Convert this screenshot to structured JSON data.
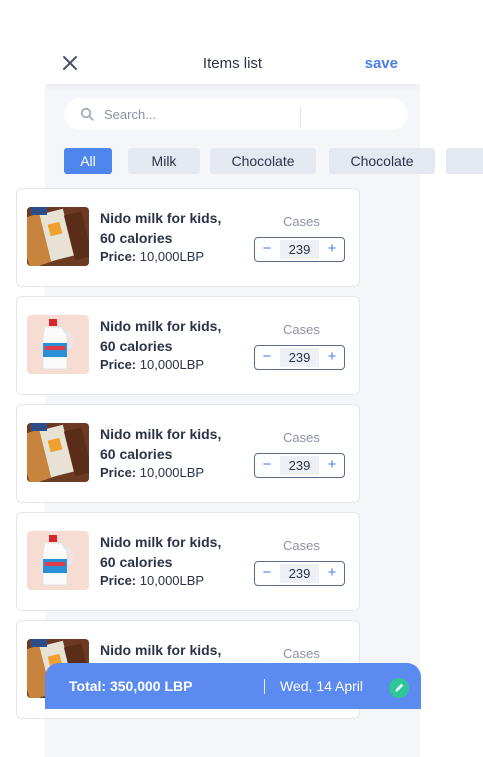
{
  "header": {
    "title": "Items list",
    "save_label": "save",
    "close_icon": "close-icon"
  },
  "search": {
    "placeholder": "Search...",
    "value": "",
    "icon": "search-icon"
  },
  "filters": [
    "All",
    "Milk",
    "Chocolate",
    "Chocolate",
    ""
  ],
  "active_filter": "All",
  "items": [
    {
      "name": "Nido milk for kids, 60 calories",
      "price_label": "Price:",
      "price": "10,000LBP",
      "qty_label": "Cases",
      "qty": "239",
      "image": "chocolate-bar-image"
    },
    {
      "name": "Nido milk for kids, 60 calories",
      "price_label": "Price:",
      "price": "10,000LBP",
      "qty_label": "Cases",
      "qty": "239",
      "image": "milk-jug-image"
    },
    {
      "name": "Nido milk for kids, 60 calories",
      "price_label": "Price:",
      "price": "10,000LBP",
      "qty_label": "Cases",
      "qty": "239",
      "image": "chocolate-bar-image"
    },
    {
      "name": "Nido milk for kids, 60 calories",
      "price_label": "Price:",
      "price": "10,000LBP",
      "qty_label": "Cases",
      "qty": "239",
      "image": "milk-jug-image"
    },
    {
      "name": "Nido milk for kids,",
      "price_label": "",
      "price": "",
      "qty_label": "Cases",
      "qty": "",
      "image": "chocolate-bar-image"
    }
  ],
  "footer": {
    "total": "Total: 350,000 LBP",
    "date": "Wed, 14 April",
    "edit_icon": "pencil-icon"
  },
  "colors": {
    "accent": "#4a7de8",
    "chip_active": "#4f86ee",
    "footer_bg": "#5b8bf0",
    "edit_btn": "#2ec79a",
    "panel_bg": "#f4f6f9"
  }
}
